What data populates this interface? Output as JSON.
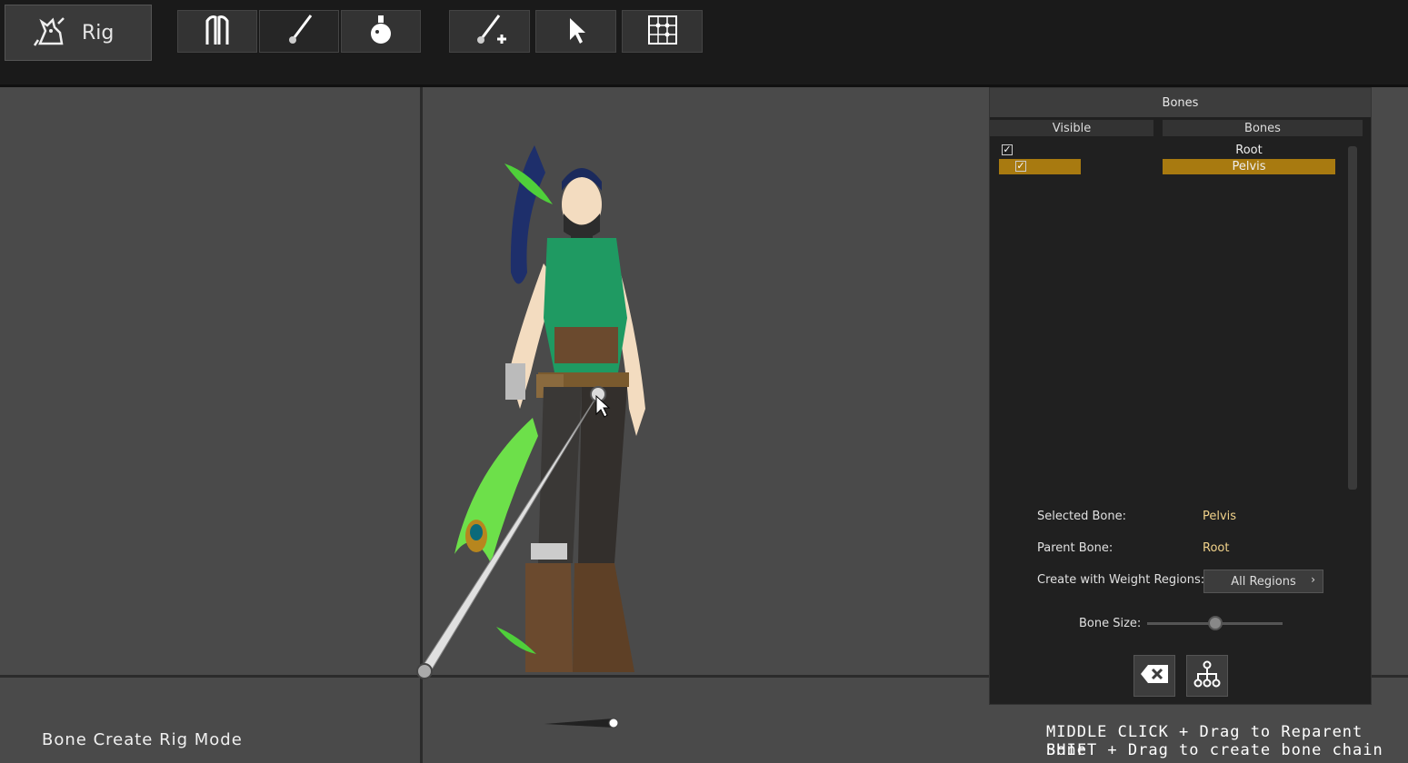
{
  "toolbar": {
    "rig_label": "Rig",
    "tools": [
      {
        "icon": "body-parts-icon"
      },
      {
        "icon": "paint-brush-icon"
      },
      {
        "icon": "potion-flask-icon"
      },
      {
        "icon": "add-bone-icon"
      },
      {
        "icon": "select-arrow-icon"
      },
      {
        "icon": "grid-points-icon"
      }
    ]
  },
  "viewport": {
    "mode_label": "Bone Create Rig Mode",
    "hints": [
      "MIDDLE CLICK + Drag to Reparent Bone",
      "SHIFT + Drag to create bone chain"
    ]
  },
  "bones_panel": {
    "title": "Bones",
    "col_visible": "Visible",
    "col_bones": "Bones",
    "bones": [
      {
        "name": "Root",
        "visible": true,
        "selected": false
      },
      {
        "name": "Pelvis",
        "visible": true,
        "selected": true
      }
    ],
    "selected_bone_label": "Selected Bone:",
    "selected_bone_value": "Pelvis",
    "parent_bone_label": "Parent Bone:",
    "parent_bone_value": "Root",
    "weight_regions_label": "Create with Weight Regions:",
    "weight_regions_value": "All Regions",
    "bone_size_label": "Bone Size:",
    "bone_size_value": 0.5,
    "colors": {
      "selection": "#a87a10",
      "value_text": "#f1d28a"
    }
  }
}
